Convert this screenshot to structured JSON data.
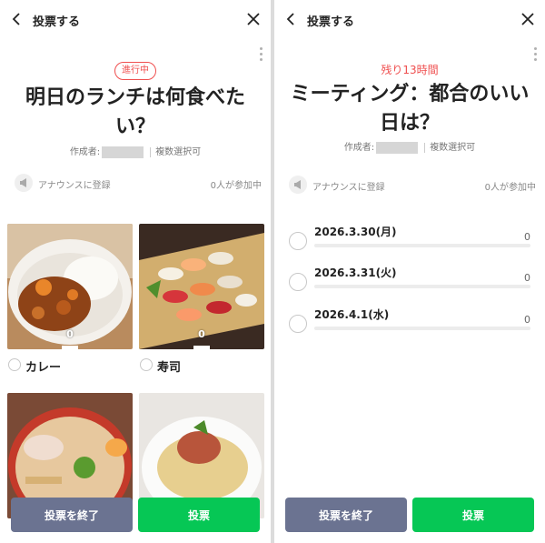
{
  "left": {
    "header": {
      "title": "投票する"
    },
    "status_badge": "進行中",
    "poll_title": "明日のランチは何食べたい？",
    "meta": {
      "author_label": "作成者:",
      "multi_select": "複数選択可"
    },
    "announce": {
      "label": "アナウンスに登録",
      "participants": "0人が参加中"
    },
    "options": [
      {
        "label": "カレー",
        "count": "0"
      },
      {
        "label": "寿司",
        "count": "0"
      }
    ],
    "footer": {
      "end_label": "投票を終了",
      "vote_label": "投票"
    }
  },
  "right": {
    "header": {
      "title": "投票する"
    },
    "remaining": "残り13時間",
    "poll_title": "ミーティング：都合のいい日は？",
    "meta": {
      "author_label": "作成者:",
      "multi_select": "複数選択可"
    },
    "announce": {
      "label": "アナウンスに登録",
      "participants": "0人が参加中"
    },
    "options": [
      {
        "label": "2026.3.30(月)",
        "count": "0",
        "progress": 0
      },
      {
        "label": "2026.3.31(火)",
        "count": "0",
        "progress": 0
      },
      {
        "label": "2026.4.1(水)",
        "count": "0",
        "progress": 0
      }
    ],
    "footer": {
      "end_label": "投票を終了",
      "vote_label": "投票"
    }
  },
  "icons": {
    "back": "chevron-left-icon",
    "close": "close-icon",
    "more": "more-vertical-icon",
    "announce": "megaphone-icon"
  },
  "colors": {
    "accent_red": "#ef4f4f",
    "vote_green": "#06c755",
    "end_button": "#6b7391"
  }
}
